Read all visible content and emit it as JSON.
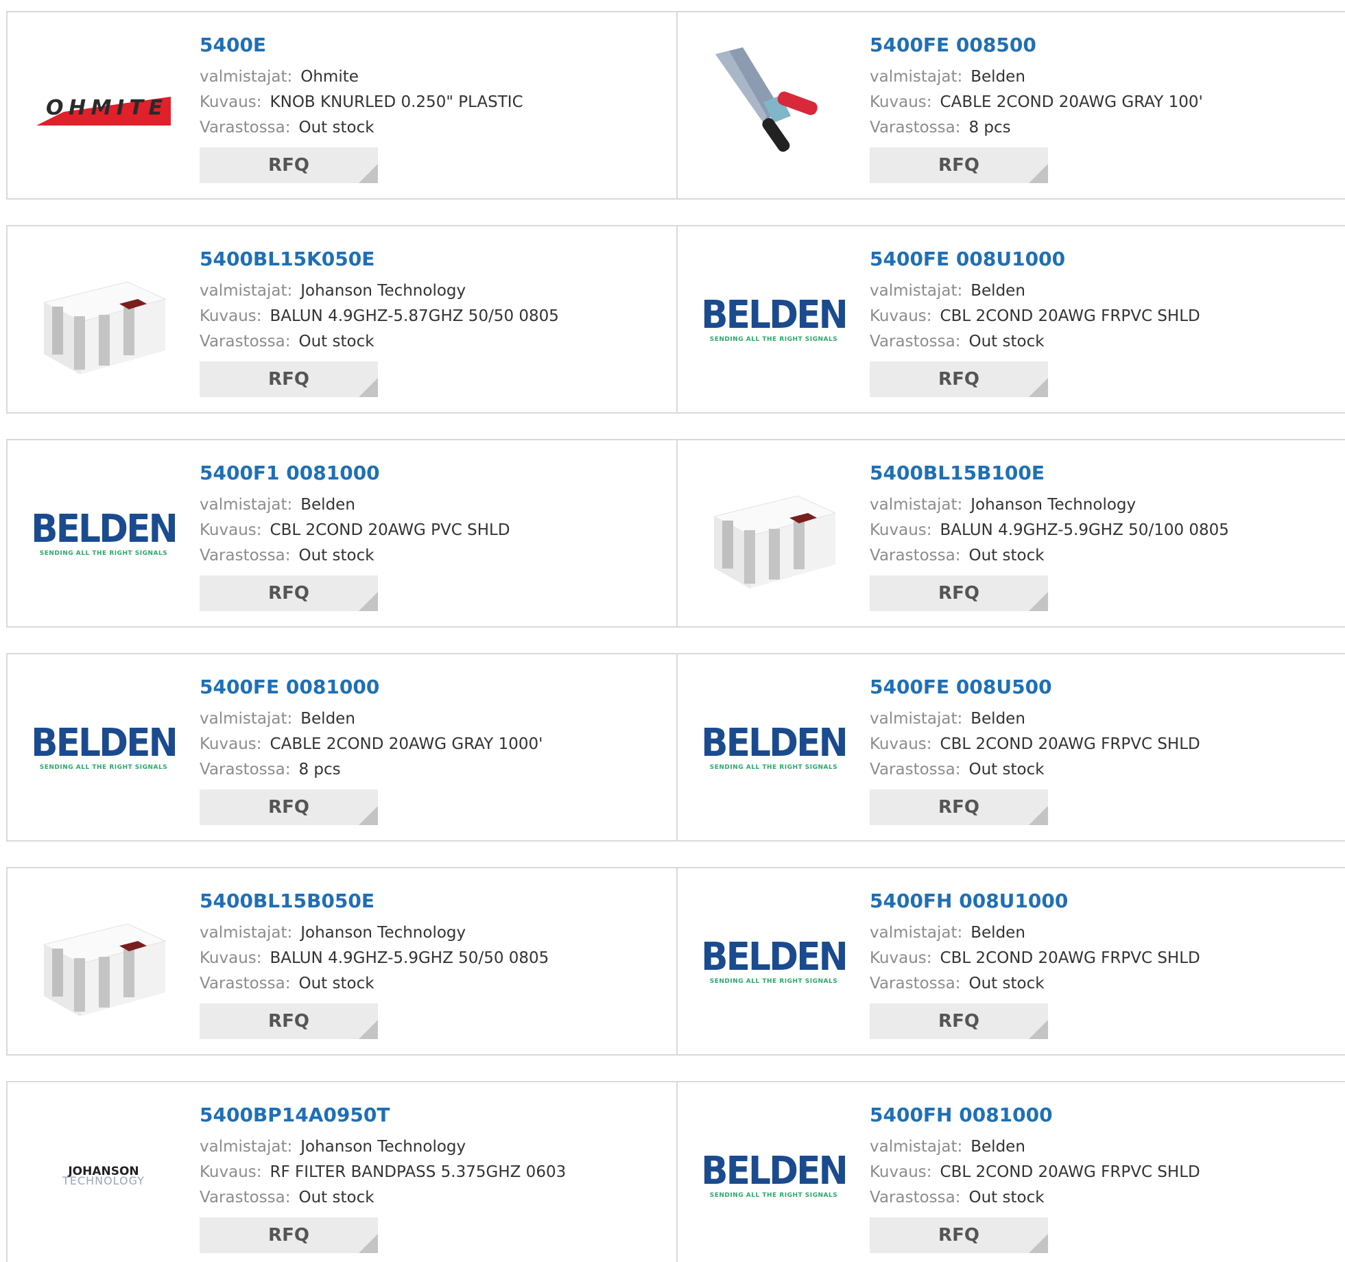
{
  "labels": {
    "manufacturer": "valmistajat:",
    "description": "Kuvaus:",
    "stock": "Varastossa:",
    "rfq": "RFQ"
  },
  "products": [
    {
      "pn": "5400E",
      "manufacturer": "Ohmite",
      "description": "KNOB KNURLED 0.250\" PLASTIC",
      "stock": "Out stock",
      "image": "ohmite-logo"
    },
    {
      "pn": "5400FE 008500",
      "manufacturer": "Belden",
      "description": "CABLE 2COND 20AWG GRAY 100'",
      "stock": "8 pcs",
      "image": "cable-photo"
    },
    {
      "pn": "5400BL15K050E",
      "manufacturer": "Johanson Technology",
      "description": "BALUN 4.9GHZ-5.87GHZ 50/50 0805",
      "stock": "Out stock",
      "image": "chip-photo"
    },
    {
      "pn": "5400FE 008U1000",
      "manufacturer": "Belden",
      "description": "CBL 2COND 20AWG FRPVC SHLD",
      "stock": "Out stock",
      "image": "belden-logo"
    },
    {
      "pn": "5400F1 0081000",
      "manufacturer": "Belden",
      "description": "CBL 2COND 20AWG PVC SHLD",
      "stock": "Out stock",
      "image": "belden-logo"
    },
    {
      "pn": "5400BL15B100E",
      "manufacturer": "Johanson Technology",
      "description": "BALUN 4.9GHZ-5.9GHZ 50/100 0805",
      "stock": "Out stock",
      "image": "chip-photo"
    },
    {
      "pn": "5400FE 0081000",
      "manufacturer": "Belden",
      "description": "CABLE 2COND 20AWG GRAY 1000'",
      "stock": "8 pcs",
      "image": "belden-logo"
    },
    {
      "pn": "5400FE 008U500",
      "manufacturer": "Belden",
      "description": "CBL 2COND 20AWG FRPVC SHLD",
      "stock": "Out stock",
      "image": "belden-logo"
    },
    {
      "pn": "5400BL15B050E",
      "manufacturer": "Johanson Technology",
      "description": "BALUN 4.9GHZ-5.9GHZ 50/50 0805",
      "stock": "Out stock",
      "image": "chip-photo"
    },
    {
      "pn": "5400FH 008U1000",
      "manufacturer": "Belden",
      "description": "CBL 2COND 20AWG FRPVC SHLD",
      "stock": "Out stock",
      "image": "belden-logo"
    },
    {
      "pn": "5400BP14A0950T",
      "manufacturer": "Johanson Technology",
      "description": "RF FILTER BANDPASS 5.375GHZ 0603",
      "stock": "Out stock",
      "image": "johanson-logo"
    },
    {
      "pn": "5400FH 0081000",
      "manufacturer": "Belden",
      "description": "CBL 2COND 20AWG FRPVC SHLD",
      "stock": "Out stock",
      "image": "belden-logo"
    }
  ],
  "logos": {
    "ohmite": "OHMITE",
    "belden_word": "BELDEN",
    "belden_tag": "SENDING ALL THE RIGHT SIGNALS",
    "johanson_1": "JOHANSON",
    "johanson_2": "TECHNOLOGY"
  },
  "colors": {
    "link": "#1f6fb5",
    "belden_blue": "#1b4b8f",
    "belden_green": "#2aa86b",
    "ohmite_red": "#e0202a"
  }
}
